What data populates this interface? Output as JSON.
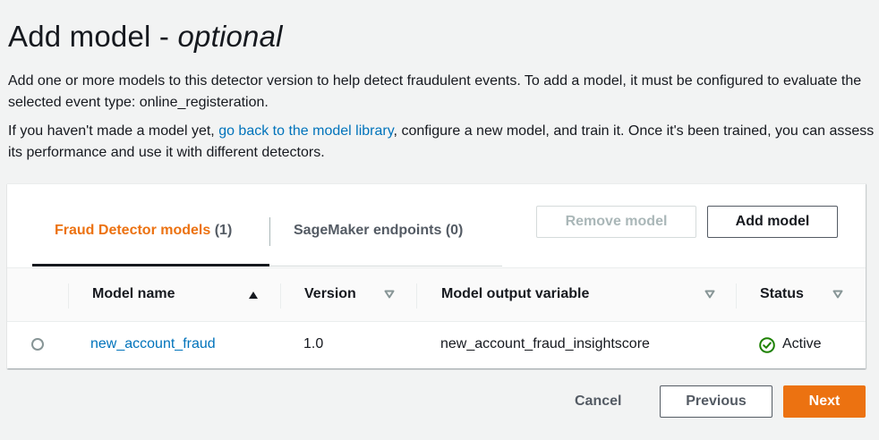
{
  "header": {
    "title_main": "Add model - ",
    "title_em": "optional"
  },
  "description": {
    "para1": "Add one or more models to this detector version to help detect fraudulent events. To add a model, it must be configured to evaluate the selected event type: online_registeration.",
    "para2_before": "If you haven't made a model yet, ",
    "para2_link": "go back to the model library",
    "para2_after": ", configure a new model, and train it. Once it's been trained, you can assess its performance and use it with different detectors."
  },
  "tabs": [
    {
      "label": "Fraud Detector models",
      "count": "(1)",
      "active": true
    },
    {
      "label": "SageMaker endpoints",
      "count": "(0)",
      "active": false
    }
  ],
  "actions": {
    "remove_label": "Remove model",
    "add_label": "Add model"
  },
  "table": {
    "columns": [
      "Model name",
      "Version",
      "Model output variable",
      "Status"
    ],
    "rows": [
      {
        "model_name": "new_account_fraud",
        "version": "1.0",
        "output_variable": "new_account_fraud_insightscore",
        "status": "Active"
      }
    ]
  },
  "footer": {
    "cancel_label": "Cancel",
    "previous_label": "Previous",
    "next_label": "Next"
  },
  "colors": {
    "accent": "#ec7211",
    "link": "#0073bb",
    "success": "#1d8102"
  }
}
